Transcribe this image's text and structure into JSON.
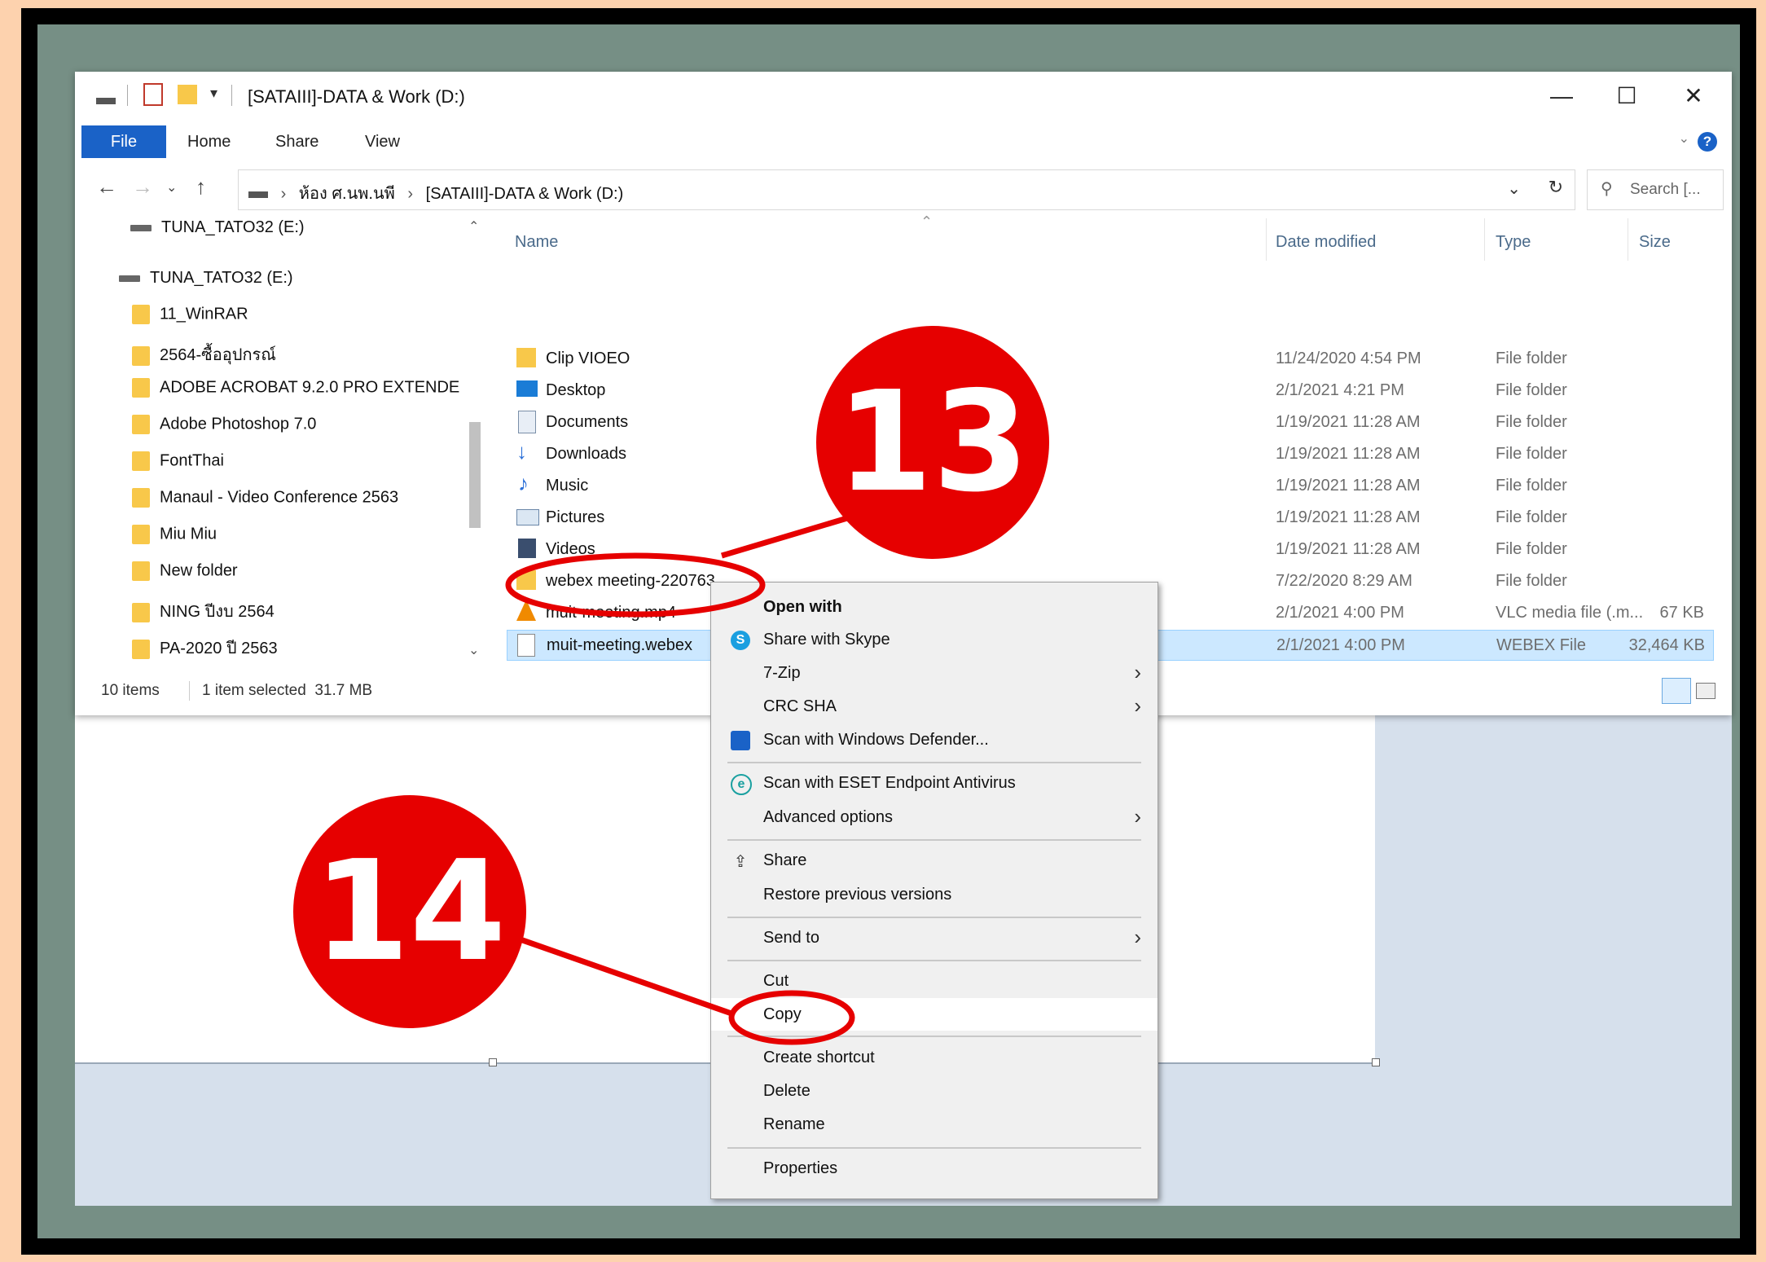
{
  "window": {
    "title": "[SATAIII]-DATA & Work (D:)",
    "minimize": "—",
    "maximize": "☐",
    "close": "✕"
  },
  "ribbon": {
    "file": "File",
    "home": "Home",
    "share": "Share",
    "view": "View"
  },
  "address": {
    "segment1": "ห้อง ศ.นพ.นพี",
    "segment2": "[SATAIII]-DATA & Work (D:)",
    "search_placeholder": "Search [..."
  },
  "nav_items": [
    {
      "label": "TUNA_TATO32 (E:)",
      "type": "drive"
    },
    {
      "label": "TUNA_TATO32 (E:)",
      "type": "drive"
    },
    {
      "label": "11_WinRAR",
      "type": "folder"
    },
    {
      "label": "2564-ซื้ออุปกรณ์",
      "type": "folder"
    },
    {
      "label": "ADOBE ACROBAT 9.2.0 PRO EXTENDE",
      "type": "folder"
    },
    {
      "label": "Adobe Photoshop 7.0",
      "type": "folder"
    },
    {
      "label": "FontThai",
      "type": "folder"
    },
    {
      "label": "Manaul - Video Conference 2563",
      "type": "folder"
    },
    {
      "label": "Miu Miu",
      "type": "folder"
    },
    {
      "label": "New folder",
      "type": "folder"
    },
    {
      "label": "NING ปีงบ 2564",
      "type": "folder"
    },
    {
      "label": "PA-2020 ปี 2563",
      "type": "folder"
    }
  ],
  "columns": {
    "name": "Name",
    "date": "Date modified",
    "type": "Type",
    "size": "Size"
  },
  "files": [
    {
      "name": "Clip VIOEO",
      "date": "11/24/2020 4:54 PM",
      "type": "File folder",
      "size": "",
      "icon": "folder-icon"
    },
    {
      "name": "Desktop",
      "date": "2/1/2021 4:21 PM",
      "type": "File folder",
      "size": "",
      "icon": "desktop-icon"
    },
    {
      "name": "Documents",
      "date": "1/19/2021 11:28 AM",
      "type": "File folder",
      "size": "",
      "icon": "documents-icon"
    },
    {
      "name": "Downloads",
      "date": "1/19/2021 11:28 AM",
      "type": "File folder",
      "size": "",
      "icon": "downloads-icon"
    },
    {
      "name": "Music",
      "date": "1/19/2021 11:28 AM",
      "type": "File folder",
      "size": "",
      "icon": "music-icon"
    },
    {
      "name": "Pictures",
      "date": "1/19/2021 11:28 AM",
      "type": "File folder",
      "size": "",
      "icon": "pictures-icon"
    },
    {
      "name": "Videos",
      "date": "1/19/2021 11:28 AM",
      "type": "File folder",
      "size": "",
      "icon": "videos-icon"
    },
    {
      "name": "webex meeting-220763",
      "date": "7/22/2020 8:29 AM",
      "type": "File folder",
      "size": "",
      "icon": "folder-icon"
    },
    {
      "name": "muit-meeting.mp4",
      "date": "2/1/2021 4:00 PM",
      "type": "VLC media file (.m...",
      "size": "67 KB",
      "icon": "vlc-icon"
    },
    {
      "name": "muit-meeting.webex",
      "date": "2/1/2021 4:00 PM",
      "type": "WEBEX File",
      "size": "32,464 KB",
      "icon": "file-icon"
    }
  ],
  "status": {
    "count": "10 items",
    "selected": "1 item selected  31.7 MB"
  },
  "context_menu": {
    "open_with": "Open with",
    "share_skype": "Share with Skype",
    "zip": "7-Zip",
    "crc": "CRC SHA",
    "defender": "Scan with Windows Defender...",
    "eset": "Scan with ESET Endpoint Antivirus",
    "advanced": "Advanced options",
    "share": "Share",
    "restore": "Restore previous versions",
    "send_to": "Send to",
    "cut": "Cut",
    "copy": "Copy",
    "shortcut": "Create shortcut",
    "delete": "Delete",
    "rename": "Rename",
    "properties": "Properties"
  },
  "annotations": {
    "step_a": "13",
    "step_b": "14",
    "color": "#e60000"
  }
}
